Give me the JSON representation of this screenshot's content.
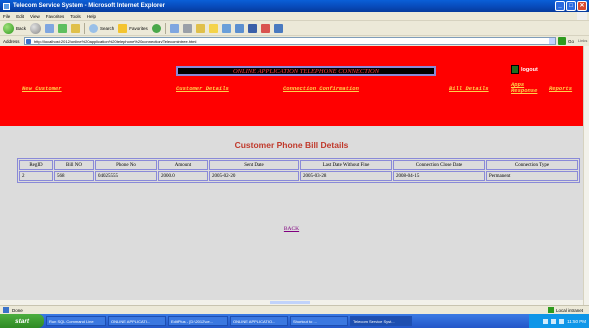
{
  "window": {
    "title": "Telecom Service System - Microsoft Internet Explorer",
    "ctl_min": "_",
    "ctl_max": "□",
    "ctl_close": "✕"
  },
  "menu": [
    "File",
    "Edit",
    "View",
    "Favorites",
    "Tools",
    "Help"
  ],
  "toolbar": {
    "back": "Back",
    "search": "Search",
    "favorites": "Favorites"
  },
  "address": {
    "label": "Address",
    "url": "http://localhost:2012/online%20application%20telephone%20connection/Telecomintree.html",
    "go": "Go",
    "links": "Links"
  },
  "header": {
    "banner": "ONLINE APPLICATION TELEPHONE CONNECTION",
    "logout": "logout",
    "nav": {
      "new_customer": "New Customer",
      "customer_details": "Customer Details",
      "connection_confirmation": "Connection Confirmation",
      "bill_details": "Bill Details",
      "apps_response": "Apps Response",
      "reports": "Reports"
    },
    "colors": {
      "background": "#ff0000",
      "link": "#ffd24a",
      "banner_text": "#ff3b3b"
    }
  },
  "page": {
    "heading": "Customer Phone Bill Details",
    "table": {
      "columns": [
        "RegID",
        "Bill NO",
        "Phone No",
        "Amount",
        "Sent Date",
        "Last Date Without Fine",
        "Connection Close Date",
        "Connection Type"
      ],
      "rows": [
        [
          "2",
          "568",
          "04025555",
          "2000.0",
          "2005-02-20",
          "2005-03-28",
          "2008-04-15",
          "Permanent"
        ]
      ]
    },
    "back": "BACK"
  },
  "status": {
    "text": "Done",
    "zone": "Local intranet"
  },
  "taskbar": {
    "start": "start",
    "tasks": [
      "Run SQL Command Line",
      "ONLINE APPLICATI...",
      "EditPlus - [D:\\2012\\ce...",
      "ONLINE APPLICATIO...",
      "Shortcut to ...",
      "Telecom Service Syst..."
    ],
    "clock": "11:50 PM"
  }
}
